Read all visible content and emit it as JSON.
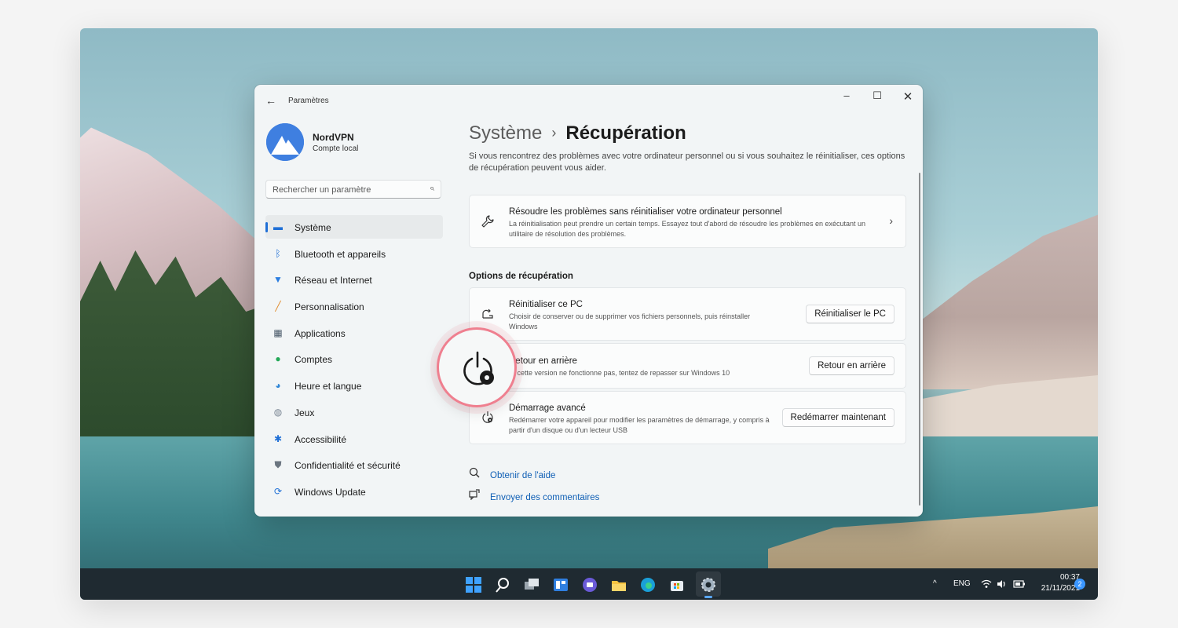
{
  "window": {
    "app_title": "Paramètres",
    "back_icon": "arrow-left-icon",
    "controls": {
      "minimize": "–",
      "maximize": "☐",
      "close": "✕"
    }
  },
  "profile": {
    "name": "NordVPN",
    "subtitle": "Compte local"
  },
  "search": {
    "placeholder": "Rechercher un paramètre",
    "icon": "⌕"
  },
  "sidebar": {
    "items": [
      {
        "label": "Système",
        "icon": "monitor-icon",
        "glyph": "▬",
        "color": "#1f6fd6",
        "active": true
      },
      {
        "label": "Bluetooth et appareils",
        "icon": "bluetooth-icon",
        "glyph": "ᛒ",
        "color": "#1f6fd6"
      },
      {
        "label": "Réseau et Internet",
        "icon": "wifi-icon",
        "glyph": "▼",
        "color": "#2b7de0"
      },
      {
        "label": "Personnalisation",
        "icon": "brush-icon",
        "glyph": "╱",
        "color": "#e08a2a"
      },
      {
        "label": "Applications",
        "icon": "apps-icon",
        "glyph": "▦",
        "color": "#4a5a6a"
      },
      {
        "label": "Comptes",
        "icon": "person-icon",
        "glyph": "●",
        "color": "#23a857"
      },
      {
        "label": "Heure et langue",
        "icon": "globe-icon",
        "glyph": "◕",
        "color": "#2f86d6"
      },
      {
        "label": "Jeux",
        "icon": "gamepad-icon",
        "glyph": "◍",
        "color": "#7b8795"
      },
      {
        "label": "Accessibilité",
        "icon": "accessibility-icon",
        "glyph": "✱",
        "color": "#1f6fd6"
      },
      {
        "label": "Confidentialité et sécurité",
        "icon": "shield-icon",
        "glyph": "⛊",
        "color": "#6b7580"
      },
      {
        "label": "Windows Update",
        "icon": "update-icon",
        "glyph": "⟳",
        "color": "#1f6fd6"
      }
    ]
  },
  "main": {
    "breadcrumb_root": "Système",
    "breadcrumb_sep": "›",
    "breadcrumb_current": "Récupération",
    "intro": "Si vous rencontrez des problèmes avec votre ordinateur personnel ou si vous souhaitez le réinitialiser, ces options de récupération peuvent vous aider.",
    "troubleshoot": {
      "icon": "wrench-icon",
      "title": "Résoudre les problèmes sans réinitialiser votre ordinateur personnel",
      "desc": "La réinitialisation peut prendre un certain temps. Essayez tout d'abord de résoudre les problèmes en exécutant un utilitaire de résolution des problèmes.",
      "chevron": "›"
    },
    "section_title": "Options de récupération",
    "options": [
      {
        "icon": "reset-pc-icon",
        "title": "Réinitialiser ce PC",
        "desc": "Choisir de conserver ou de supprimer vos fichiers personnels, puis réinstaller Windows",
        "button": "Réinitialiser le PC"
      },
      {
        "icon": "go-back-icon",
        "title": "Retour en arrière",
        "desc": "Si cette version ne fonctionne pas, tentez de repasser sur Windows 10",
        "button": "Retour en arrière"
      },
      {
        "icon": "advanced-startup-icon",
        "title": "Démarrage avancé",
        "desc": "Redémarrer votre appareil pour modifier les paramètres de démarrage, y compris à partir d'un disque ou d'un lecteur USB",
        "button": "Redémarrer maintenant"
      }
    ],
    "links": [
      {
        "label": "Obtenir de l'aide",
        "icon": "help-icon",
        "glyph": "🔍"
      },
      {
        "label": "Envoyer des commentaires",
        "icon": "feedback-icon",
        "glyph": "✎"
      }
    ]
  },
  "taskbar": {
    "tray": {
      "chevron": "^",
      "language": "ENG",
      "wifi": "wifi-icon",
      "volume": "volume-icon",
      "battery": "battery-icon"
    },
    "clock": {
      "time": "00:37",
      "date": "21/11/2021"
    },
    "notifications": "2"
  },
  "colors": {
    "accent": "#1f6fd6",
    "highlight_ring": "#ef7f8f",
    "taskbar": "#1f2a31"
  }
}
